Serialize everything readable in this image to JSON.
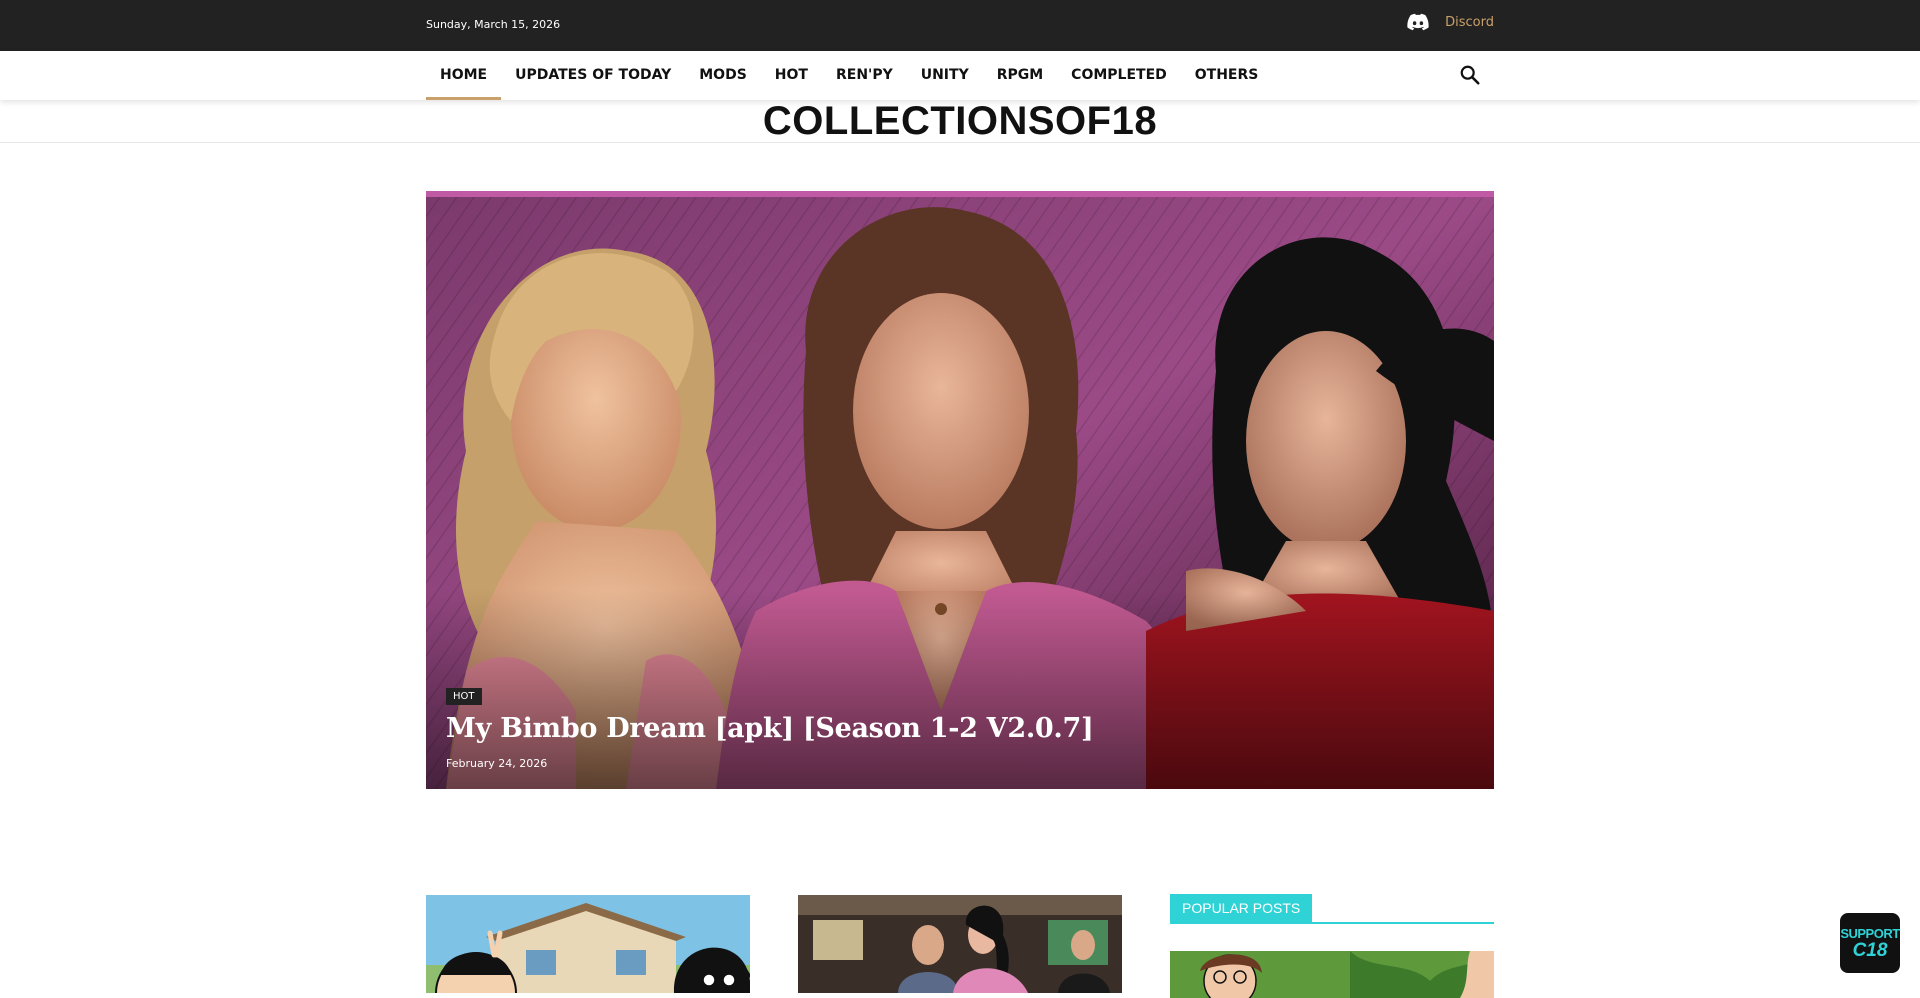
{
  "topbar": {
    "date": "Sunday, March 15, 2026",
    "discord_icon": "discord-icon",
    "discord_label": "Discord"
  },
  "nav": {
    "items": [
      {
        "label": "HOME",
        "active": true
      },
      {
        "label": "UPDATES OF TODAY"
      },
      {
        "label": "MODS"
      },
      {
        "label": "HOT"
      },
      {
        "label": "REN'PY"
      },
      {
        "label": "UNITY"
      },
      {
        "label": "RPGM"
      },
      {
        "label": "COMPLETED"
      },
      {
        "label": "OTHERS"
      }
    ],
    "search_icon": "search-icon",
    "accent_color": "#c9a06a"
  },
  "site": {
    "logo": "COLLECTIONSOF18"
  },
  "hero": {
    "category": "HOT",
    "title": "My Bimbo Dream [apk] [Season 1-2 V2.0.7]",
    "date": "February 24, 2026"
  },
  "sidebar": {
    "popular_label": "POPULAR POSTS",
    "accent_color": "#2fd3d6"
  },
  "support_widget": {
    "line1": "SUPPORT",
    "line2": "C18"
  }
}
